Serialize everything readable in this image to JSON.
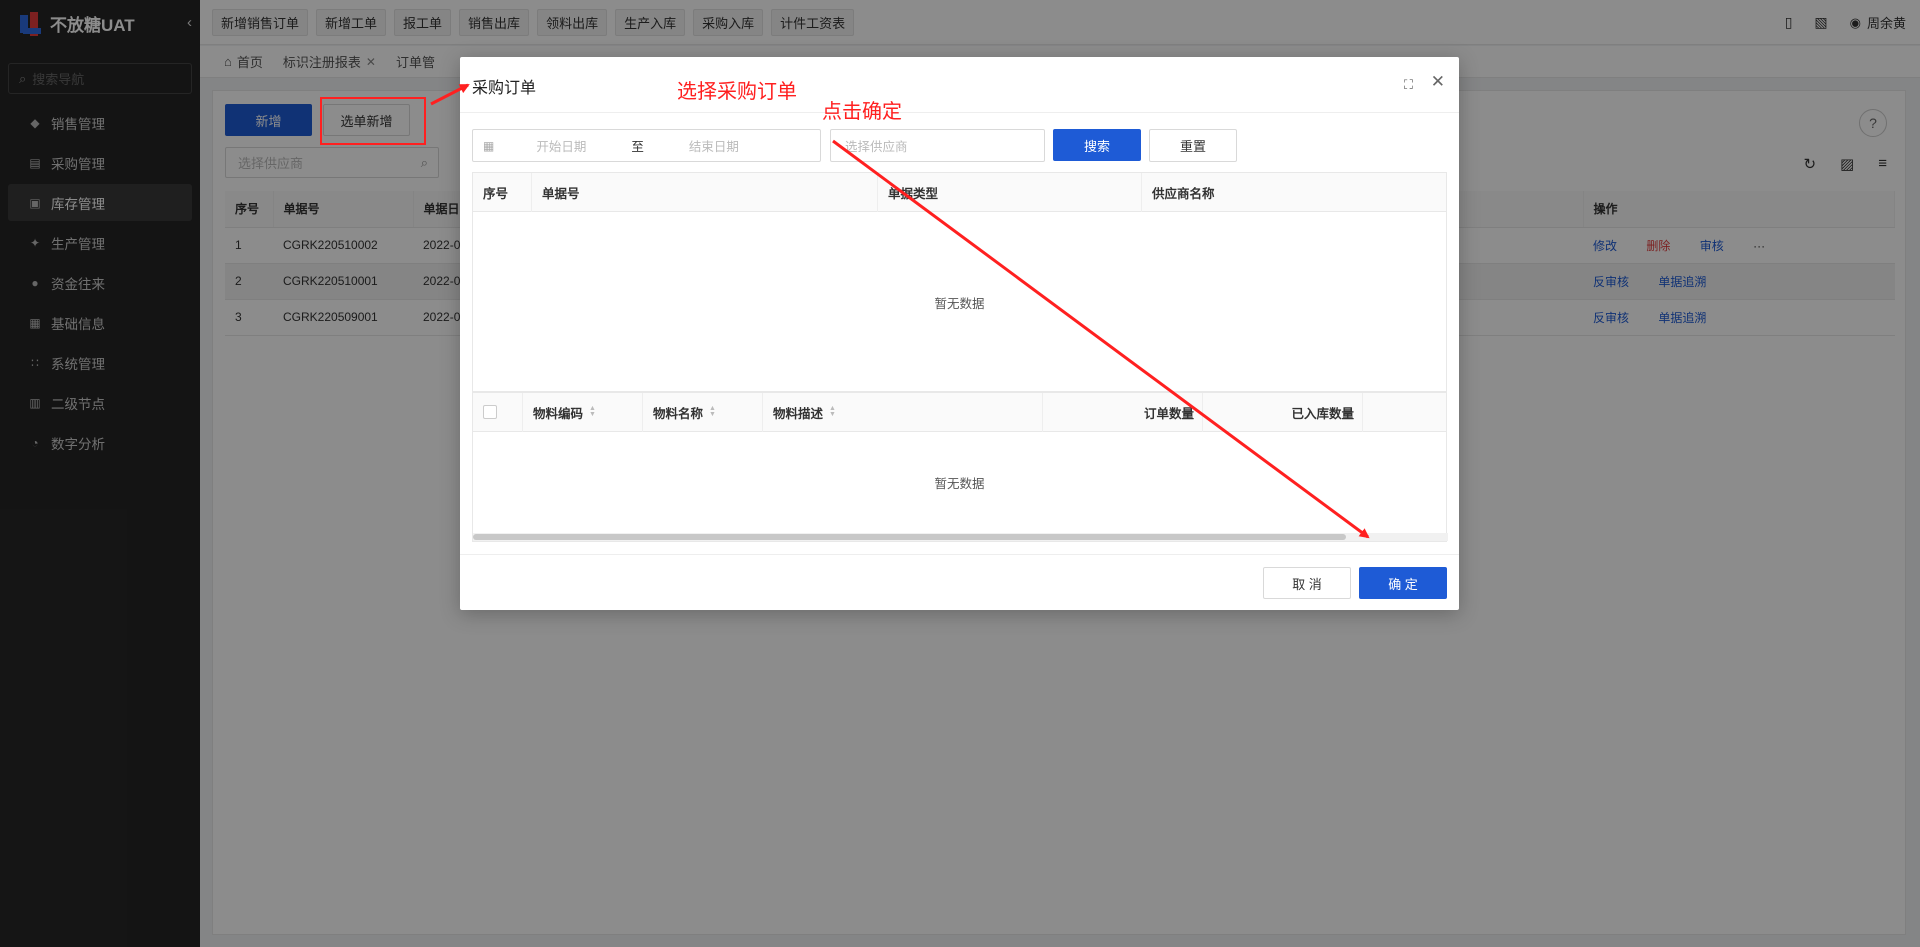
{
  "app": {
    "title": "不放糖UAT",
    "collapse_icon": "chevron-left-icon"
  },
  "sidebar": {
    "search_placeholder": "搜索导航",
    "items": [
      {
        "label": "销售管理",
        "icon": "tag-icon"
      },
      {
        "label": "采购管理",
        "icon": "cart-icon"
      },
      {
        "label": "库存管理",
        "icon": "warehouse-icon",
        "active": true
      },
      {
        "label": "生产管理",
        "icon": "production-icon"
      },
      {
        "label": "资金往来",
        "icon": "money-icon"
      },
      {
        "label": "基础信息",
        "icon": "grid-icon"
      },
      {
        "label": "系统管理",
        "icon": "apps-icon"
      },
      {
        "label": "二级节点",
        "icon": "document-icon"
      },
      {
        "label": "数字分析",
        "icon": "pie-chart-icon"
      }
    ]
  },
  "topbar": {
    "quick_links": [
      "新增销售订单",
      "新增工单",
      "报工单",
      "销售出库",
      "领料出库",
      "生产入库",
      "采购入库",
      "计件工资表"
    ],
    "user_name": "周余黄"
  },
  "tabs": [
    {
      "label": "首页",
      "closable": false
    },
    {
      "label": "标识注册报表",
      "closable": true
    },
    {
      "label": "订单管",
      "closable": false
    }
  ],
  "content": {
    "add_button": "新增",
    "select_add_button": "选单新增",
    "supplier_placeholder": "选择供应商",
    "columns": [
      "序号",
      "单据号",
      "单据日",
      "操作"
    ],
    "rows": [
      {
        "no": "1",
        "doc": "CGRK220510002",
        "date": "2022-0",
        "actions": [
          "修改",
          "删除",
          "审核"
        ],
        "more": "···"
      },
      {
        "no": "2",
        "doc": "CGRK220510001",
        "date": "2022-0",
        "actions": [
          "反审核",
          "单据追溯"
        ],
        "more": ""
      },
      {
        "no": "3",
        "doc": "CGRK220509001",
        "date": "2022-0",
        "actions": [
          "反审核",
          "单据追溯"
        ],
        "more": ""
      }
    ]
  },
  "modal": {
    "title": "采购订单",
    "start_placeholder": "开始日期",
    "range_sep": "至",
    "end_placeholder": "结束日期",
    "supplier_placeholder": "选择供应商",
    "search_button": "搜索",
    "reset_button": "重置",
    "order_columns": [
      "序号",
      "单据号",
      "单据类型",
      "供应商名称"
    ],
    "empty_text": "暂无数据",
    "detail_columns": [
      "物料编码",
      "物料名称",
      "物料描述",
      "订单数量",
      "已入库数量"
    ],
    "cancel_button": "取 消",
    "ok_button": "确 定"
  },
  "annotations": {
    "select_order": "选择采购订单",
    "click_ok": "点击确定",
    "color": "#ff2020"
  }
}
